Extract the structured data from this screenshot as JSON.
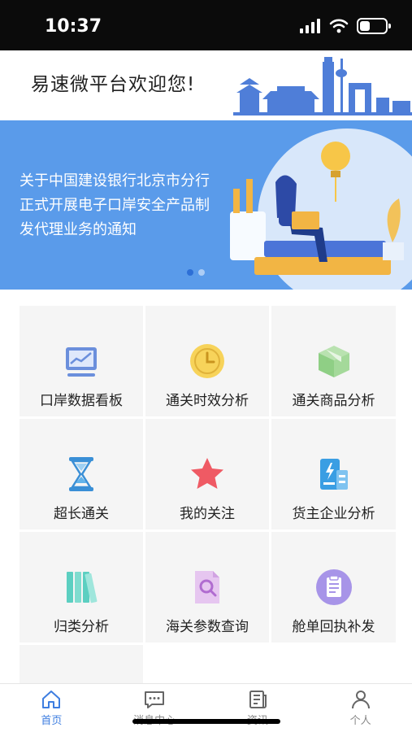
{
  "status": {
    "time": "10:37"
  },
  "header": {
    "welcome": "易速微平台欢迎您!"
  },
  "banner": {
    "text": "关于中国建设银行北京市分行正式开展电子口岸安全产品制发代理业务的通知",
    "slides": 2,
    "active_slide": 1
  },
  "tiles": [
    {
      "label": "口岸数据看板",
      "icon": "chart-board-icon"
    },
    {
      "label": "通关时效分析",
      "icon": "clock-icon"
    },
    {
      "label": "通关商品分析",
      "icon": "box-icon"
    },
    {
      "label": "超长通关",
      "icon": "hourglass-icon"
    },
    {
      "label": "我的关注",
      "icon": "star-icon"
    },
    {
      "label": "货主企业分析",
      "icon": "building-icon"
    },
    {
      "label": "归类分析",
      "icon": "books-icon"
    },
    {
      "label": "海关参数查询",
      "icon": "document-search-icon"
    },
    {
      "label": "舱单回执补发",
      "icon": "clipboard-icon"
    }
  ],
  "nav": {
    "items": [
      {
        "label": "首页",
        "icon": "home-icon",
        "active": true
      },
      {
        "label": "消息中心",
        "icon": "message-icon",
        "active": false
      },
      {
        "label": "资讯",
        "icon": "news-icon",
        "active": false
      },
      {
        "label": "个人",
        "icon": "person-icon",
        "active": false
      }
    ]
  },
  "colors": {
    "banner": "#5a9bea",
    "accent": "#3e7ee0",
    "tile_bg": "#f5f5f5"
  }
}
